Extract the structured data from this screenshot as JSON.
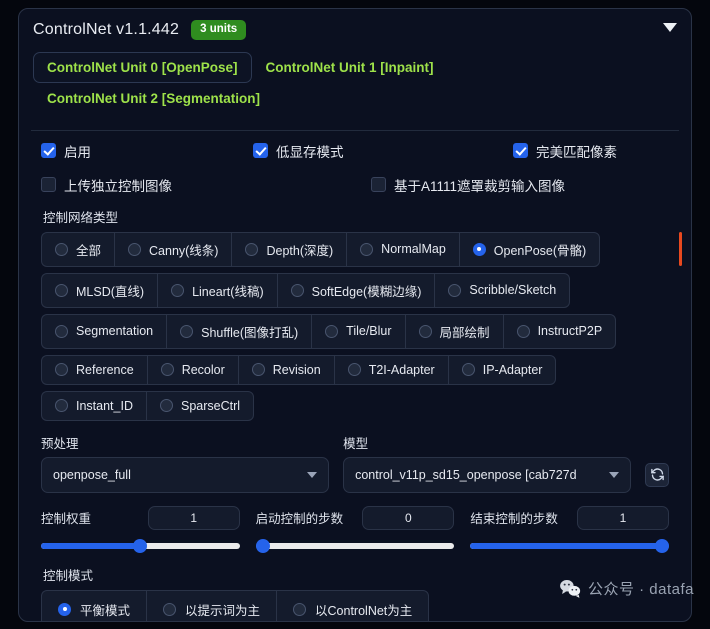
{
  "header": {
    "title": "ControlNet v1.1.442",
    "units_badge": "3 units",
    "collapse_icon": "chevron-down-icon"
  },
  "tabs": [
    {
      "label": "ControlNet Unit 0 [OpenPose]",
      "active": true
    },
    {
      "label": "ControlNet Unit 1 [Inpaint]",
      "active": false
    },
    {
      "label": "ControlNet Unit 2 [Segmentation]",
      "active": false
    }
  ],
  "checkboxes": {
    "row1": [
      {
        "label": "启用",
        "checked": true
      },
      {
        "label": "低显存模式",
        "checked": true
      },
      {
        "label": "完美匹配像素",
        "checked": true
      }
    ],
    "row2": [
      {
        "label": "上传独立控制图像",
        "checked": false
      },
      {
        "label": "基于A1111遮罩裁剪输入图像",
        "checked": false
      }
    ]
  },
  "control_type": {
    "label": "控制网络类型",
    "selected": "OpenPose(骨骼)",
    "marker_color": "#e8491f",
    "rows": [
      [
        "全部",
        "Canny(线条)",
        "Depth(深度)",
        "NormalMap",
        "OpenPose(骨骼)"
      ],
      [
        "MLSD(直线)",
        "Lineart(线稿)",
        "SoftEdge(模糊边缘)",
        "Scribble/Sketch"
      ],
      [
        "Segmentation",
        "Shuffle(图像打乱)",
        "Tile/Blur",
        "局部绘制",
        "InstructP2P"
      ],
      [
        "Reference",
        "Recolor",
        "Revision",
        "T2I-Adapter",
        "IP-Adapter"
      ],
      [
        "Instant_ID",
        "SparseCtrl"
      ]
    ]
  },
  "preprocessor": {
    "label": "预处理",
    "value": "openpose_full",
    "caret_icon": "chevron-down-icon"
  },
  "model": {
    "label": "模型",
    "value": "control_v11p_sd15_openpose [cab727d",
    "caret_icon": "chevron-down-icon",
    "refresh_icon": "refresh-icon"
  },
  "sliders": [
    {
      "label": "控制权重",
      "value": "1",
      "fill_percent": 50
    },
    {
      "label": "启动控制的步数",
      "value": "0",
      "fill_percent": 0
    },
    {
      "label": "结束控制的步数",
      "value": "1",
      "fill_percent": 100
    }
  ],
  "control_mode": {
    "label": "控制模式",
    "selected": "平衡模式",
    "options": [
      "平衡模式",
      "以提示词为主",
      "以ControlNet为主"
    ]
  },
  "watermark": {
    "icon": "wechat-icon",
    "text": "公众号 · datafa"
  },
  "colors": {
    "accent_blue": "#2563eb",
    "tab_green": "#9ee24a",
    "badge_green": "#2f8c1f",
    "marker_red": "#e8491f",
    "panel_bg": "#0b1020"
  }
}
